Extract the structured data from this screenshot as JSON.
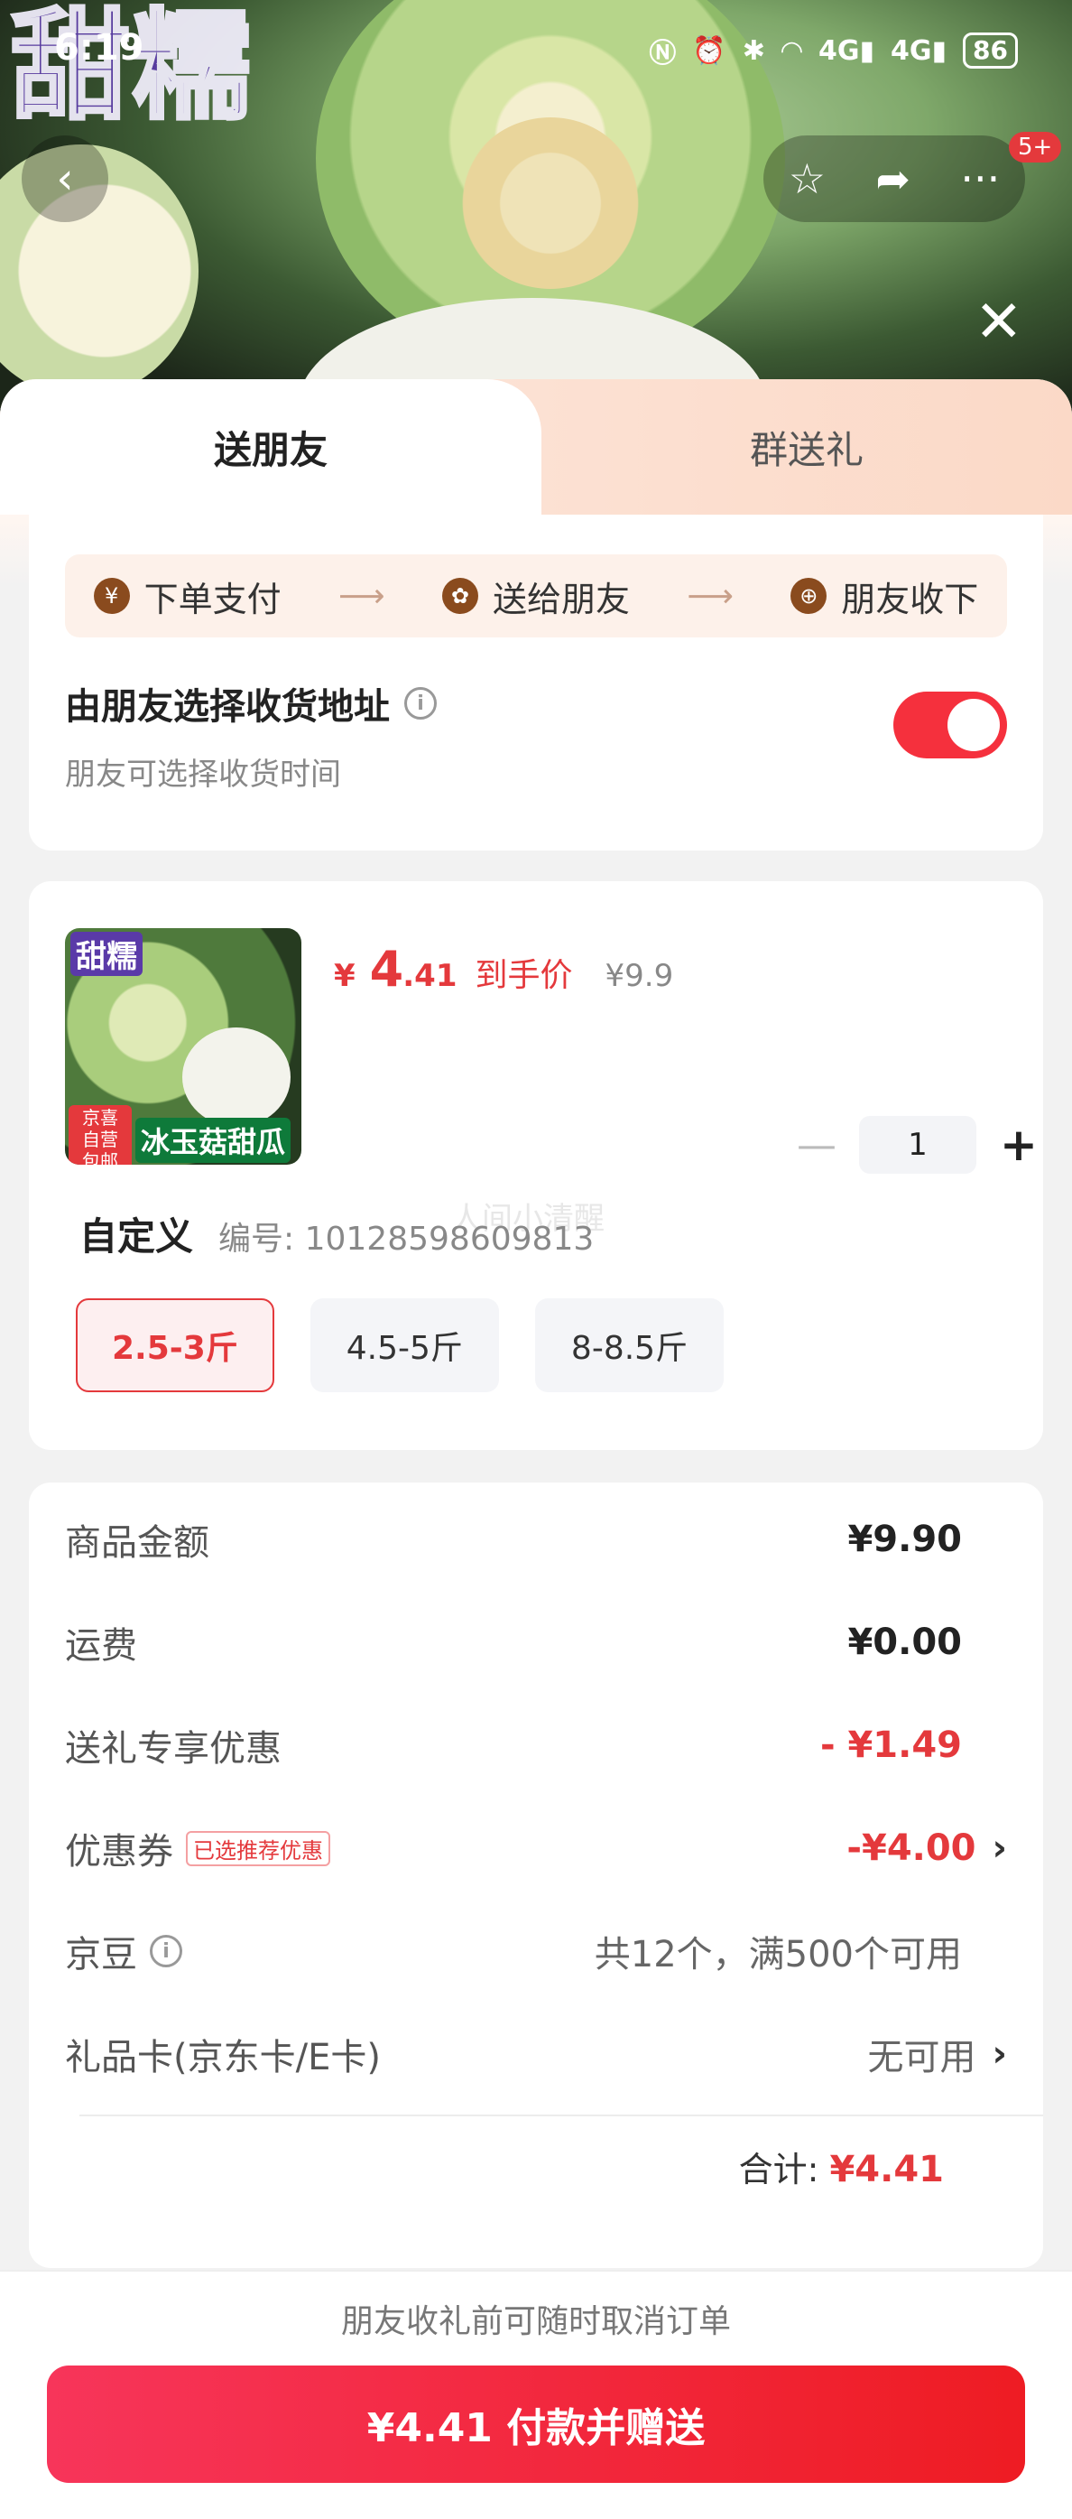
{
  "status_bar": {
    "time": "6:19",
    "icons": [
      "nfc-icon",
      "alarm-icon",
      "bluetooth-icon",
      "wifi-icon",
      "4g-signal-icon",
      "4g-signal-icon"
    ],
    "network_label": "4G",
    "battery": "86"
  },
  "hero": {
    "image_text": "甜糯",
    "notification_count": "5+"
  },
  "tabs": [
    {
      "label": "送朋友",
      "active": true
    },
    {
      "label": "群送礼",
      "active": false
    }
  ],
  "steps": [
    {
      "icon": "¥",
      "label": "下单支付"
    },
    {
      "icon": "✿",
      "label": "送给朋友"
    },
    {
      "icon": "⊕",
      "label": "朋友收下"
    }
  ],
  "address_option": {
    "title": "由朋友选择收货地址",
    "subtitle": "朋友可选择收货时间",
    "enabled": true
  },
  "product": {
    "thumb_title": "甜糯",
    "thumb_tag": "京喜自营 包邮",
    "thumb_name": "冰玉菇甜瓜",
    "price_symbol": "¥",
    "price_int": "4",
    "price_dec": ".41",
    "price_label": "到手价",
    "original_price": "¥9.9",
    "quantity": "1",
    "spec_label": "自定义",
    "spec_code": "编号: 10128598609813",
    "watermark": "人间小清醒",
    "options": [
      {
        "label": "2.5-3斤",
        "selected": true
      },
      {
        "label": "4.5-5斤",
        "selected": false
      },
      {
        "label": "8-8.5斤",
        "selected": false
      }
    ]
  },
  "summary": {
    "rows": [
      {
        "label": "商品金额",
        "value": "¥9.90"
      },
      {
        "label": "运费",
        "value": "¥0.00"
      },
      {
        "label": "送礼专享优惠",
        "value": "- ¥1.49"
      },
      {
        "label": "优惠券",
        "badge": "已选推荐优惠",
        "value": "-¥4.00"
      },
      {
        "label": "京豆",
        "value": "共12个，满500个可用"
      },
      {
        "label": "礼品卡(京东卡/E卡)",
        "value": "无可用"
      }
    ],
    "total_label": "合计:",
    "total_value": "¥4.41"
  },
  "footer": {
    "note": "朋友收礼前可随时取消订单",
    "pay_button": "¥4.41 付款并赠送"
  },
  "colors": {
    "accent_red": "#e4393c",
    "toggle_on": "#f5303d",
    "pay_gradient_start": "#f7355a",
    "pay_gradient_end": "#ee1c23"
  }
}
